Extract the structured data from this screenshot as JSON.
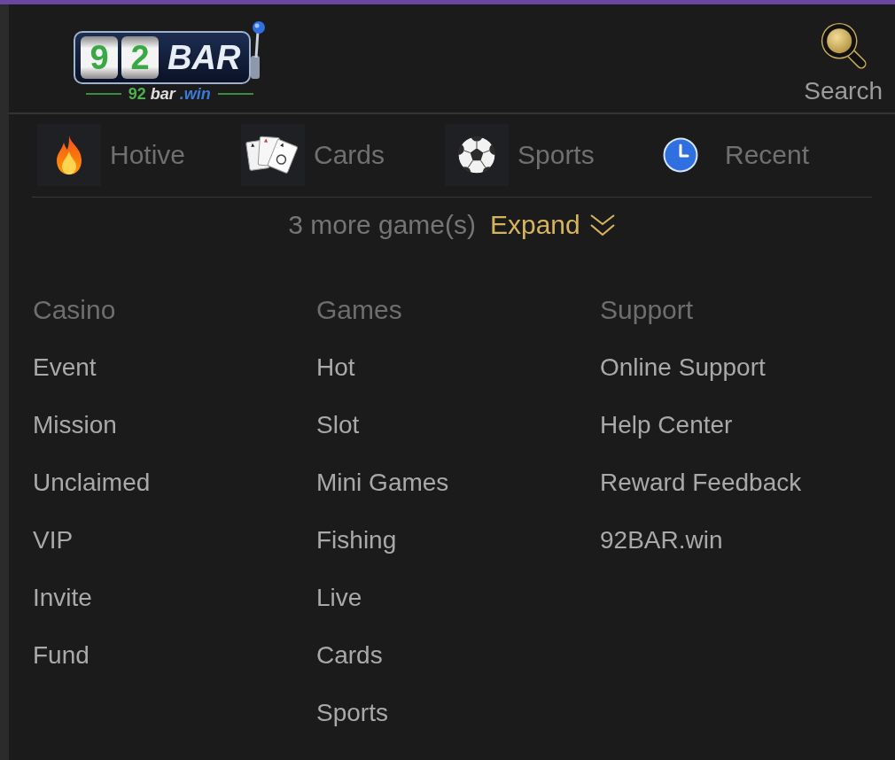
{
  "header": {
    "logo": {
      "reels": [
        "9",
        "2"
      ],
      "wordmark": "BAR",
      "domain_parts": [
        "92",
        "bar",
        ".win"
      ]
    },
    "search": {
      "label": "Search"
    }
  },
  "categories": [
    {
      "label": "Hotive"
    },
    {
      "label": "Cards"
    },
    {
      "label": "Sports"
    },
    {
      "label": "Recent"
    }
  ],
  "more_games": {
    "count_text": "3 more game(s)",
    "action": "Expand"
  },
  "footer": {
    "columns": [
      {
        "heading": "Casino",
        "links": [
          "Event",
          "Mission",
          "Unclaimed",
          "VIP",
          "Invite",
          "Fund"
        ]
      },
      {
        "heading": "Games",
        "links": [
          "Hot",
          "Slot",
          "Mini Games",
          "Fishing",
          "Live",
          "Cards",
          "Sports"
        ]
      },
      {
        "heading": "Support",
        "links": [
          "Online Support",
          "Help Center",
          "Reward Feedback",
          "92BAR.win"
        ]
      }
    ]
  }
}
